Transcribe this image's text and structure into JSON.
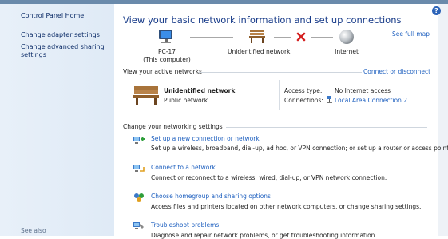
{
  "sidebar": {
    "home": "Control Panel Home",
    "items": [
      "Change adapter settings",
      "Change advanced sharing settings"
    ],
    "see_also": "See also"
  },
  "help": {
    "label": "?"
  },
  "header": {
    "title": "View your basic network information and set up connections",
    "see_full_map": "See full map"
  },
  "map": {
    "computer_name": "PC-17",
    "computer_sub": "(This computer)",
    "network": "Unidentified network",
    "internet": "Internet"
  },
  "active": {
    "header": "View your active networks",
    "connect_link": "Connect or disconnect",
    "network_name": "Unidentified network",
    "network_type": "Public network",
    "access_label": "Access type:",
    "access_value": "No Internet access",
    "connections_label": "Connections:",
    "connections_value": "Local Area Connection 2"
  },
  "settings": {
    "header": "Change your networking settings",
    "tasks": [
      {
        "title": "Set up a new connection or network",
        "desc": "Set up a wireless, broadband, dial-up, ad hoc, or VPN connection; or set up a router or access point.",
        "icon": "new-connection-icon"
      },
      {
        "title": "Connect to a network",
        "desc": "Connect or reconnect to a wireless, wired, dial-up, or VPN network connection.",
        "icon": "connect-network-icon"
      },
      {
        "title": "Choose homegroup and sharing options",
        "desc": "Access files and printers located on other network computers, or change sharing settings.",
        "icon": "homegroup-icon"
      },
      {
        "title": "Troubleshoot problems",
        "desc": "Diagnose and repair network problems, or get troubleshooting information.",
        "icon": "troubleshoot-icon"
      }
    ]
  },
  "colors": {
    "link": "#1d5fbf",
    "title": "#1a3d8a",
    "sidebar": "#e3ecf7",
    "error_x": "#d42020"
  }
}
